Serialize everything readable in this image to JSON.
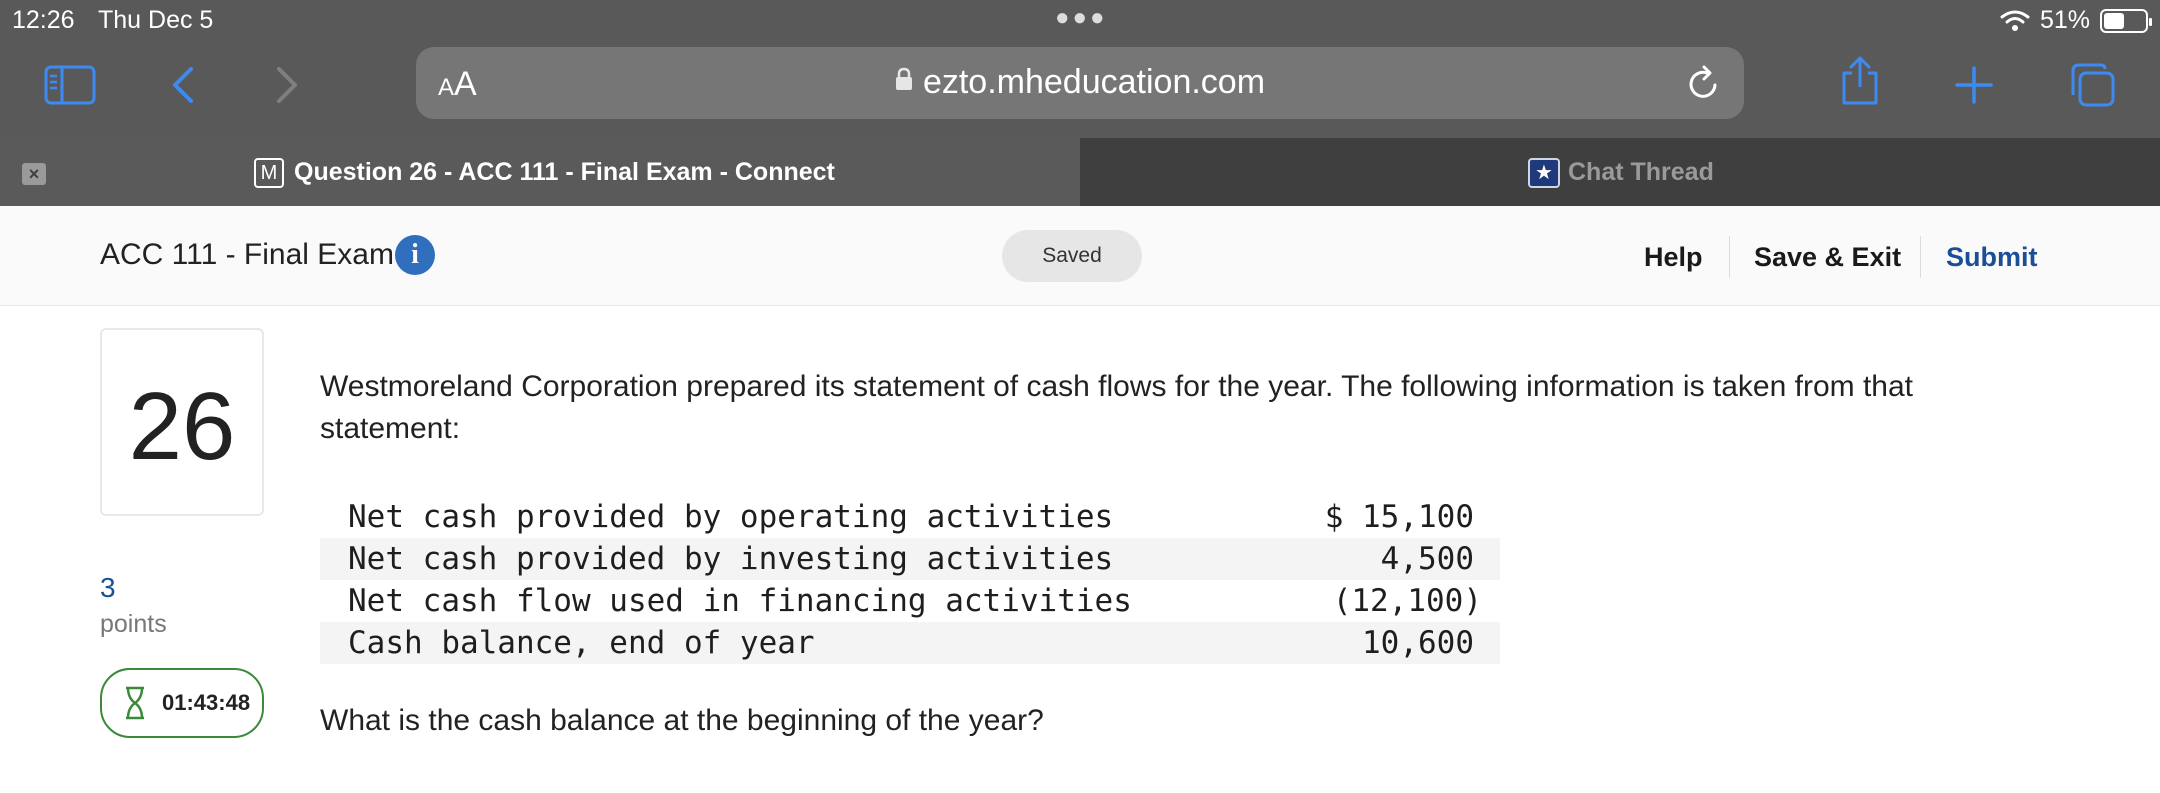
{
  "status_bar": {
    "time": "12:26",
    "date": "Thu Dec 5",
    "battery_percent": "51%",
    "battery_level": 0.51
  },
  "browser": {
    "text_size_label": "AA",
    "url": "ezto.mheducation.com",
    "icons": [
      "sidebar-icon",
      "back-icon",
      "forward-icon",
      "lock-icon",
      "reload-icon",
      "share-icon",
      "new-tab-icon",
      "tabs-icon"
    ]
  },
  "tabs": [
    {
      "favicon": "M",
      "title": "Question 26 - ACC 111 - Final Exam - Connect",
      "active": true
    },
    {
      "favicon": "★",
      "title": "Chat Thread",
      "active": false
    }
  ],
  "exam_header": {
    "title": "ACC 111 - Final Exam",
    "info_glyph": "i",
    "saved_label": "Saved",
    "help_label": "Help",
    "save_exit_label": "Save & Exit",
    "submit_label": "Submit"
  },
  "question": {
    "number": "26",
    "points": "3",
    "points_label": "points",
    "timer": "01:43:48",
    "prompt": "Westmoreland Corporation prepared its statement of cash flows for the year. The following information is taken from that statement:",
    "table": [
      {
        "label": "Net cash provided by operating activities",
        "value": "$ 15,100"
      },
      {
        "label": "Net cash provided by investing activities",
        "value": "4,500"
      },
      {
        "label": "Net cash flow used in financing activities",
        "value": "(12,100)"
      },
      {
        "label": "Cash balance, end of year",
        "value": "10,600"
      }
    ],
    "follow_up": "What is the cash balance at the beginning of the year?"
  },
  "colors": {
    "chrome_bg": "#595959",
    "accent_blue": "#3d8bf2",
    "submit_blue": "#1a4f96",
    "timer_green": "#3a8a3a"
  }
}
